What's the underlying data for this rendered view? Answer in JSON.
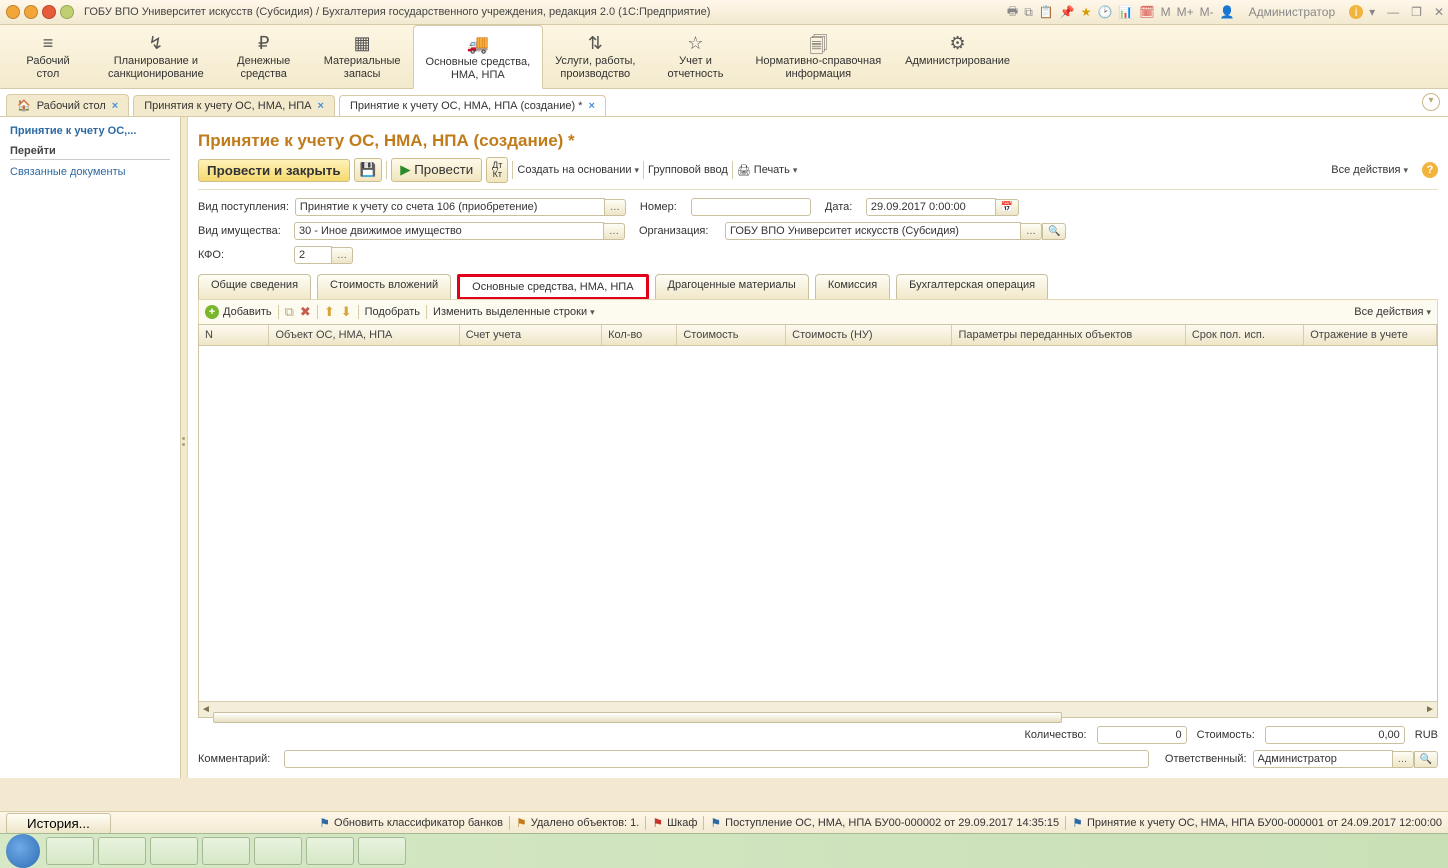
{
  "titlebar": {
    "title": "ГОБУ ВПО Университет искусств (Субсидия) / Бухгалтерия государственного учреждения, редакция 2.0  (1С:Предприятие)",
    "m_markers": {
      "m": "M",
      "mplus": "M+",
      "mminus": "M-"
    },
    "user": "Администратор"
  },
  "sections": [
    {
      "icon": "≡",
      "label": "Рабочий\nстол"
    },
    {
      "icon": "↯",
      "label": "Планирование и\nсанкционирование"
    },
    {
      "icon": "₽",
      "label": "Денежные\nсредства"
    },
    {
      "icon": "▦",
      "label": "Материальные\nзапасы"
    },
    {
      "icon": "🚚",
      "label": "Основные средства,\nНМА, НПА",
      "active": true
    },
    {
      "icon": "⇅",
      "label": "Услуги, работы,\nпроизводство"
    },
    {
      "icon": "☆",
      "label": "Учет и\nотчетность"
    },
    {
      "icon": "🗐",
      "label": "Нормативно-справочная\nинформация"
    },
    {
      "icon": "⚙",
      "label": "Администрирование"
    }
  ],
  "doctabs": [
    {
      "label": "Рабочий стол",
      "icon": "🏠"
    },
    {
      "label": "Принятия к учету ОС, НМА, НПА"
    },
    {
      "label": "Принятие к учету ОС, НМА, НПА (создание) *",
      "active": true
    }
  ],
  "sidebar": {
    "title": "Принятие к учету ОС,...",
    "group": "Перейти",
    "link": "Связанные документы"
  },
  "page": {
    "title": "Принятие к учету ОС, НМА, НПА (создание) *",
    "toolbar": {
      "post_close": "Провести и закрыть",
      "post": "Провести",
      "create_on_basis": "Создать на основании",
      "group_input": "Групповой ввод",
      "print": "Печать",
      "all_actions": "Все действия"
    },
    "fields": {
      "receipt_type_lbl": "Вид поступления:",
      "receipt_type_val": "Принятие к учету со счета 106 (приобретение)",
      "number_lbl": "Номер:",
      "number_val": "",
      "date_lbl": "Дата:",
      "date_val": "29.09.2017 0:00:00",
      "asset_type_lbl": "Вид имущества:",
      "asset_type_val": "30 - Иное движимое имущество",
      "org_lbl": "Организация:",
      "org_val": "ГОБУ ВПО Университет искусств (Субсидия)",
      "kfo_lbl": "КФО:",
      "kfo_val": "2"
    },
    "inner_tabs": [
      "Общие сведения",
      "Стоимость вложений",
      "Основные средства, НМА, НПА",
      "Драгоценные материалы",
      "Комиссия",
      "Бухгалтерская операция"
    ],
    "grid_toolbar": {
      "add": "Добавить",
      "pick": "Подобрать",
      "change_lines": "Изменить выделенные строки",
      "all_actions": "Все действия"
    },
    "grid_columns": [
      "N",
      "Объект ОС, НМА, НПА",
      "Счет учета",
      "Кол-во",
      "Стоимость",
      "Стоимость (НУ)",
      "Параметры переданных объектов",
      "Срок пол. исп.",
      "Отражение в учете"
    ],
    "totals": {
      "qty_lbl": "Количество:",
      "qty_val": "0",
      "cost_lbl": "Стоимость:",
      "cost_val": "0,00",
      "currency": "RUB"
    },
    "comment_lbl": "Комментарий:",
    "responsible_lbl": "Ответственный:",
    "responsible_val": "Администратор"
  },
  "statusbar": {
    "history": "История...",
    "items": [
      {
        "icon": "blue",
        "text": "Обновить классификатор банков"
      },
      {
        "icon": "orange",
        "text": "Удалено объектов: 1."
      },
      {
        "icon": "red",
        "text": "Шкаф"
      },
      {
        "icon": "blue",
        "text": "Поступление ОС, НМА, НПА БУ00-000002 от 29.09.2017 14:35:15"
      },
      {
        "icon": "blue",
        "text": "Принятие к учету ОС, НМА, НПА БУ00-000001 от 24.09.2017 12:00:00"
      }
    ]
  }
}
